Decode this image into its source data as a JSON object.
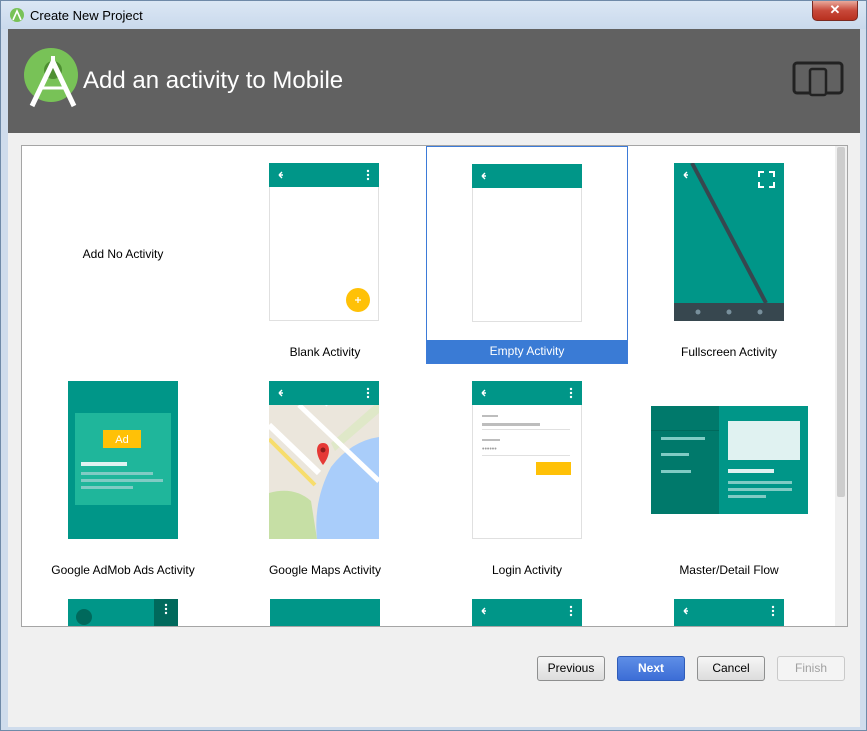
{
  "window": {
    "title": "Create New Project",
    "close_label": "✕"
  },
  "header": {
    "title": "Add an activity to Mobile"
  },
  "templates": [
    {
      "label": "Add No Activity"
    },
    {
      "label": "Blank Activity"
    },
    {
      "label": "Empty Activity"
    },
    {
      "label": "Fullscreen Activity"
    },
    {
      "label": "Google AdMob Ads Activity",
      "ad_badge": "Ad"
    },
    {
      "label": "Google Maps Activity"
    },
    {
      "label": "Login Activity"
    },
    {
      "label": "Master/Detail Flow"
    }
  ],
  "buttons": {
    "previous": "Previous",
    "next": "Next",
    "cancel": "Cancel",
    "finish": "Finish"
  },
  "colors": {
    "teal": "#009688",
    "dark_teal": "#00796b",
    "header_bg": "#616161",
    "fab": "#ffc107",
    "selection": "#3a7bd5"
  }
}
